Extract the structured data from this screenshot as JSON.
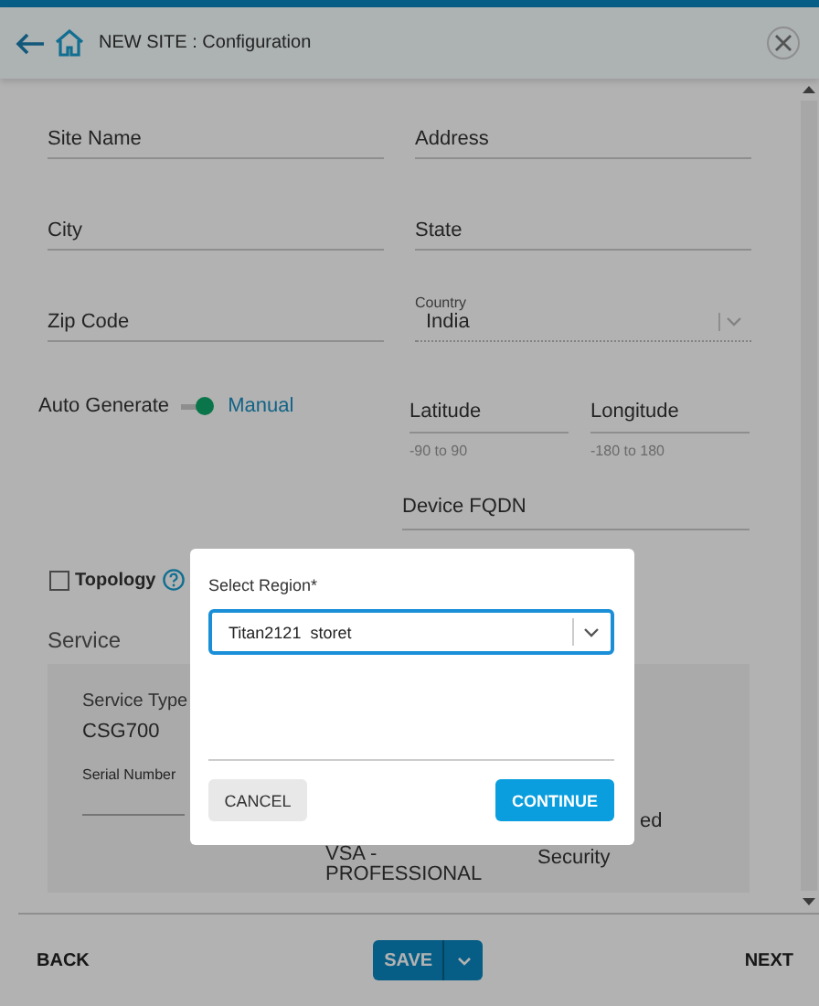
{
  "header": {
    "title": "NEW SITE : Configuration"
  },
  "fields": [
    {
      "kind": "text",
      "label": "Site Name"
    },
    {
      "kind": "text",
      "label": "Address"
    },
    {
      "kind": "text",
      "label": "City"
    },
    {
      "kind": "text",
      "label": "State"
    },
    {
      "kind": "text",
      "label": "Zip Code"
    }
  ],
  "country": {
    "label": "Country",
    "value": "India"
  },
  "auto_generate": {
    "label": "Auto Generate",
    "option": "Manual",
    "on": true
  },
  "coordinates": [
    {
      "label": "Latitude",
      "hint": "-90 to 90"
    },
    {
      "label": "Longitude",
      "hint": "-180 to 180"
    }
  ],
  "device_fqdn": {
    "label": "Device FQDN"
  },
  "topology": {
    "label": "Topology",
    "checked": false
  },
  "service": {
    "title": "Service",
    "service_type_label": "Service Type",
    "service_type": "CSG700",
    "serial_number_label": "Serial Number",
    "column_2": "VSA -\nPROFESSIONAL",
    "column_3": [
      "ed",
      "Security"
    ]
  },
  "footer": {
    "back": "BACK",
    "save": "SAVE",
    "next": "NEXT"
  },
  "dialog": {
    "label": "Select Region*",
    "value": "Titan2121  storet",
    "cancel": "CANCEL",
    "continue": "CONTINUE"
  }
}
